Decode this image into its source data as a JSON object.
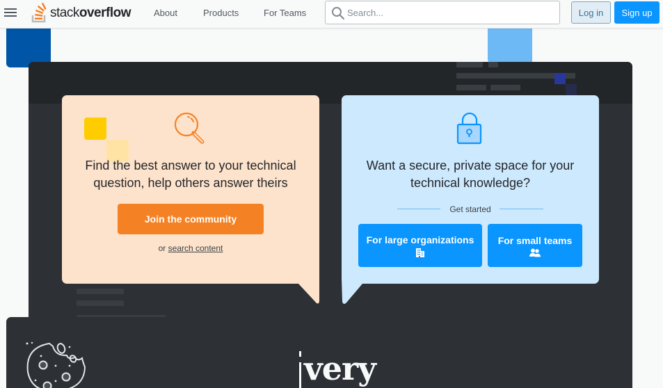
{
  "topbar": {
    "logo": {
      "light": "stack",
      "bold": "overflow"
    },
    "nav": [
      "About",
      "Products",
      "For Teams"
    ],
    "search": {
      "placeholder": "Search...",
      "value": ""
    },
    "login_label": "Log in",
    "signup_label": "Sign up"
  },
  "community_card": {
    "text_line1": "Find the best answer to your technical",
    "text_line2": "question, help others answer theirs",
    "join_label": "Join the community",
    "or_text": "or",
    "search_link": "search content"
  },
  "teams_card": {
    "text_line1": "Want a secure, private space for your",
    "text_line2": "technical knowledge?",
    "divider_label": "Get started",
    "large_org_label": "For large organizations",
    "small_team_label": "For small teams"
  },
  "bottom": {
    "heading_fragment": "very"
  },
  "colors": {
    "brand_orange": "#f48225",
    "primary_blue": "#0a95ff",
    "dark_panel": "#2d3034",
    "orange_card": "#fee3cc",
    "blue_card": "#cde9fe"
  }
}
